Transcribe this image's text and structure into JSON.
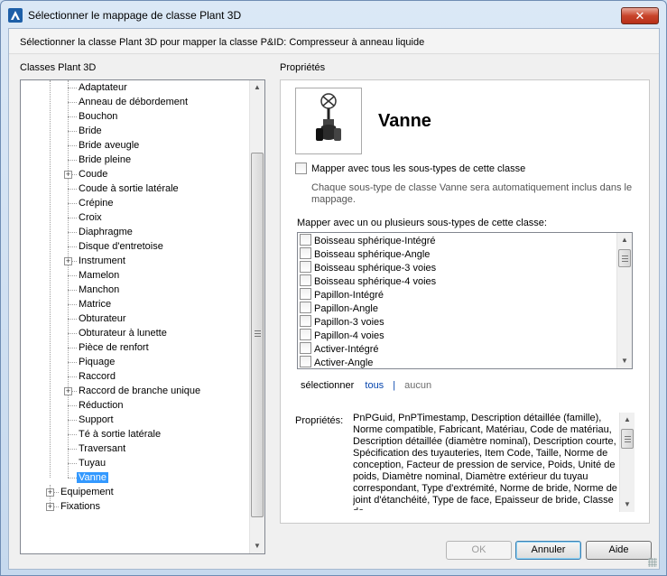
{
  "window": {
    "title": "Sélectionner le mappage de classe Plant 3D",
    "close_symbol": "✕"
  },
  "instruction": "Sélectionner la classe Plant 3D pour mapper la classe P&ID: Compresseur à anneau liquide",
  "tree": {
    "label": "Classes Plant 3D",
    "items": [
      {
        "label": "Adaptateur",
        "level": 2,
        "expandable": false
      },
      {
        "label": "Anneau de débordement",
        "level": 2,
        "expandable": false
      },
      {
        "label": "Bouchon",
        "level": 2,
        "expandable": false
      },
      {
        "label": "Bride",
        "level": 2,
        "expandable": false
      },
      {
        "label": "Bride aveugle",
        "level": 2,
        "expandable": false
      },
      {
        "label": "Bride pleine",
        "level": 2,
        "expandable": false
      },
      {
        "label": "Coude",
        "level": 2,
        "expandable": true
      },
      {
        "label": "Coude à sortie latérale",
        "level": 2,
        "expandable": false
      },
      {
        "label": "Crépine",
        "level": 2,
        "expandable": false
      },
      {
        "label": "Croix",
        "level": 2,
        "expandable": false
      },
      {
        "label": "Diaphragme",
        "level": 2,
        "expandable": false
      },
      {
        "label": "Disque d'entretoise",
        "level": 2,
        "expandable": false
      },
      {
        "label": "Instrument",
        "level": 2,
        "expandable": true
      },
      {
        "label": "Mamelon",
        "level": 2,
        "expandable": false
      },
      {
        "label": "Manchon",
        "level": 2,
        "expandable": false
      },
      {
        "label": "Matrice",
        "level": 2,
        "expandable": false
      },
      {
        "label": "Obturateur",
        "level": 2,
        "expandable": false
      },
      {
        "label": "Obturateur à lunette",
        "level": 2,
        "expandable": false
      },
      {
        "label": "Pièce de renfort",
        "level": 2,
        "expandable": false
      },
      {
        "label": "Piquage",
        "level": 2,
        "expandable": false
      },
      {
        "label": "Raccord",
        "level": 2,
        "expandable": false
      },
      {
        "label": "Raccord de branche unique",
        "level": 2,
        "expandable": true
      },
      {
        "label": "Réduction",
        "level": 2,
        "expandable": false
      },
      {
        "label": "Support",
        "level": 2,
        "expandable": false
      },
      {
        "label": "Té à sortie latérale",
        "level": 2,
        "expandable": false
      },
      {
        "label": "Traversant",
        "level": 2,
        "expandable": false
      },
      {
        "label": "Tuyau",
        "level": 2,
        "expandable": false
      },
      {
        "label": "Vanne",
        "level": 2,
        "expandable": false,
        "selected": true
      },
      {
        "label": "Equipement",
        "level": 1,
        "expandable": true
      },
      {
        "label": "Fixations",
        "level": 1,
        "expandable": true
      }
    ]
  },
  "properties": {
    "label": "Propriétés",
    "class_name": "Vanne",
    "map_all_label": "Mapper avec tous les sous-types de cette classe",
    "map_all_note": "Chaque sous-type de classe Vanne sera automatiquement inclus dans le mappage.",
    "map_multi_label": "Mapper avec un ou plusieurs sous-types de cette classe:",
    "subtypes": [
      "Boisseau sphérique-Intégré",
      "Boisseau sphérique-Angle",
      "Boisseau sphérique-3 voies",
      "Boisseau sphérique-4 voies",
      "Papillon-Intégré",
      "Papillon-Angle",
      "Papillon-3 voies",
      "Papillon-4 voies",
      "Activer-Intégré",
      "Activer-Angle"
    ],
    "select_label": "sélectionner",
    "select_all": "tous",
    "select_sep": "|",
    "select_none": "aucun",
    "props_label": "Propriétés:",
    "props_text": "PnPGuid, PnPTimestamp, Description détaillée (famille), Norme compatible, Fabricant, Matériau, Code de matériau, Description détaillée (diamètre nominal), Description courte, Spécification des tuyauteries, Item Code, Taille, Norme de conception, Facteur de pression de service, Poids, Unité de poids, Diamètre nominal, Diamètre extérieur du tuyau correspondant, Type d'extrémité, Norme de bride, Norme de joint d'étanchéité, Type de face, Epaisseur de bride, Classe de"
  },
  "buttons": {
    "ok": "OK",
    "cancel": "Annuler",
    "help": "Aide"
  }
}
